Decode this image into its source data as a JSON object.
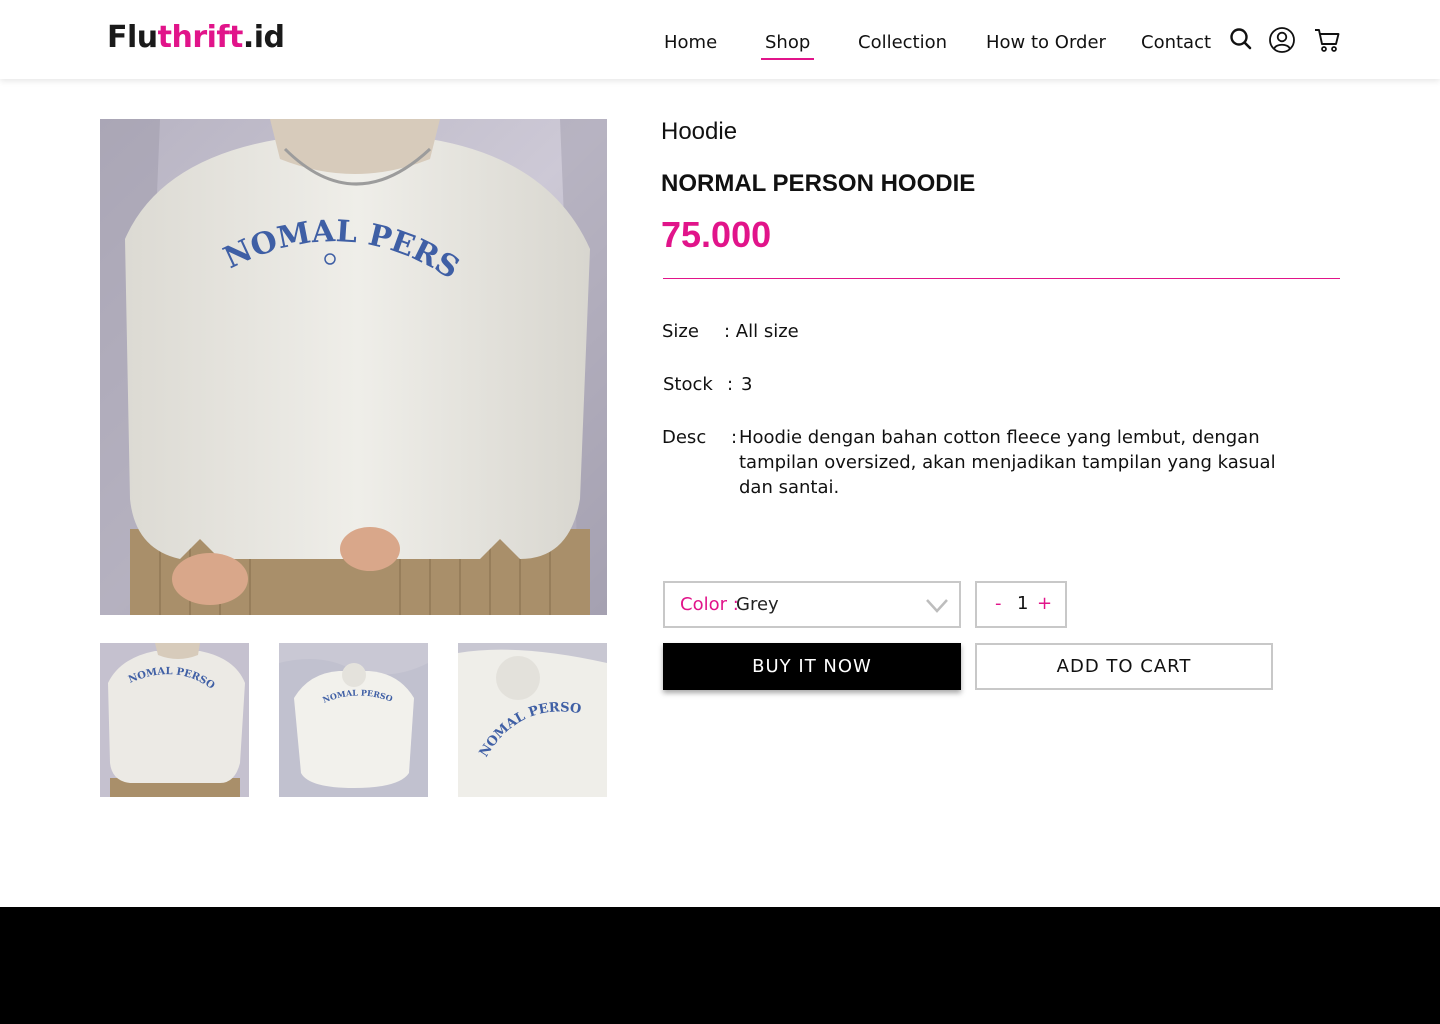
{
  "brand": {
    "part1": "Flu",
    "part2": "thrift",
    "part3": ".id"
  },
  "nav": {
    "items": [
      {
        "label": "Home"
      },
      {
        "label": "Shop"
      },
      {
        "label": "Collection"
      },
      {
        "label": "How to Order"
      },
      {
        "label": "Contact"
      }
    ],
    "active": "Shop",
    "icons": [
      "search-icon",
      "user-icon",
      "cart-icon"
    ]
  },
  "product": {
    "category": "Hoodie",
    "name": "NORMAL PERSON HOODIE",
    "price": "75.000",
    "size_label": "Size",
    "size_value": ": All size",
    "stock_label": "Stock",
    "stock_colon": ":",
    "stock_value": "3",
    "desc_label": "Desc",
    "desc_colon": ":",
    "desc_value": "Hoodie dengan bahan cotton fleece yang lembut, dengan tampilan oversized, akan menjadikan tampilan yang kasual dan santai.",
    "main_image_print": "NOMAL PERSON",
    "thumbnail_prints": [
      "NOMAL PERSON",
      "NOMAL PERSON",
      "NOMAL PERSON"
    ]
  },
  "options": {
    "color_label": "Color :",
    "color_value": "Grey",
    "qty_minus": "-",
    "qty_value": "1",
    "qty_plus": "+"
  },
  "actions": {
    "buy_now": "BUY IT NOW",
    "add_to_cart": "ADD TO CART"
  },
  "colors": {
    "accent": "#e1148a",
    "text": "#111111",
    "footer": "#000000",
    "border": "#c8c8c8"
  }
}
